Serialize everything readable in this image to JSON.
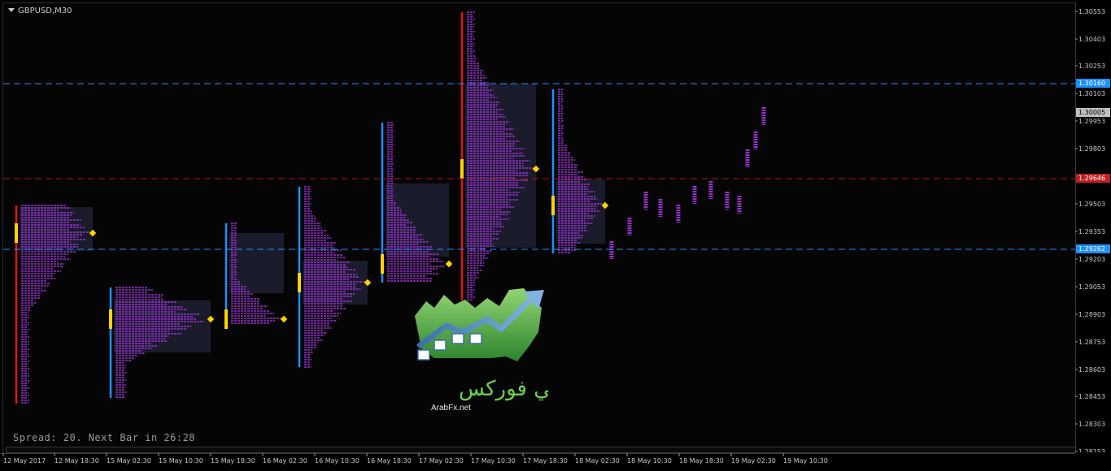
{
  "window": {
    "symbol_title": "GBPUSD,M30",
    "status_text": "Spread: 20. Next Bar in 26:28"
  },
  "watermark": {
    "arabic_text": "عربي فوركس",
    "site": "ArabFx.net"
  },
  "colors": {
    "background": "#000000",
    "profile": "#9a2fd0",
    "value_area": "#1a1c2c",
    "blue_line": "#1e90ff",
    "red_line": "#b01818",
    "poc": "#ffd400",
    "tag_blue": "#1e90ff",
    "tag_gray": "#bfbfbf",
    "tag_red": "#c02020"
  },
  "chart_data": {
    "type": "market_profile",
    "symbol": "GBPUSD",
    "timeframe": "M30",
    "y_ticks": [
      "1.30553",
      "1.30403",
      "1.30253",
      "1.30103",
      "1.29953",
      "1.29803",
      "1.29503",
      "1.29353",
      "1.29203",
      "1.29053",
      "1.28903",
      "1.28753",
      "1.28603",
      "1.28453",
      "1.28303",
      "1.28153"
    ],
    "ylim": [
      1.2815,
      1.306
    ],
    "price_tags": [
      {
        "label": "1.30160",
        "value": 1.3016,
        "style": "blue"
      },
      {
        "label": "1.30005",
        "value": 1.30005,
        "style": "gray"
      },
      {
        "label": "1.29646",
        "value": 1.29646,
        "style": "red"
      },
      {
        "label": "1.29262",
        "value": 1.29262,
        "style": "blue"
      }
    ],
    "horizontal_lines": [
      {
        "value": 1.3016,
        "style": "blue-dashed"
      },
      {
        "value": 1.29646,
        "style": "red-dashed"
      },
      {
        "value": 1.29262,
        "style": "blue-dashed"
      }
    ],
    "x_ticks": [
      "12 May 2017",
      "12 May 18:30",
      "15 May 02:30",
      "15 May 10:30",
      "15 May 18:30",
      "16 May 02:30",
      "16 May 10:30",
      "16 May 18:30",
      "17 May 02:30",
      "17 May 10:30",
      "17 May 18:30",
      "18 May 02:30",
      "18 May 10:30",
      "18 May 18:30",
      "19 May 02:30",
      "19 May 10:30"
    ],
    "profiles": [
      {
        "session": 1,
        "high": 1.295,
        "low": 1.2842,
        "value_area": [
          1.2925,
          1.2949
        ],
        "poc": 1.2935,
        "range_color": "red"
      },
      {
        "session": 2,
        "high": 1.2905,
        "low": 1.2845,
        "value_area": [
          1.287,
          1.2898
        ],
        "poc": 1.2888,
        "range_color": "blue"
      },
      {
        "session": 3,
        "high": 1.294,
        "low": 1.2885,
        "value_area": [
          1.2902,
          1.2935
        ],
        "poc": 1.2888,
        "range_color": "blue"
      },
      {
        "session": 4,
        "high": 1.296,
        "low": 1.2862,
        "value_area": [
          1.2896,
          1.292
        ],
        "poc": 1.2908,
        "range_color": "blue"
      },
      {
        "session": 5,
        "high": 1.2995,
        "low": 1.2908,
        "value_area": [
          1.2922,
          1.2962
        ],
        "poc": 1.2918,
        "range_color": "blue"
      },
      {
        "session": 6,
        "high": 1.3055,
        "low": 1.2898,
        "value_area": [
          1.2927,
          1.3016
        ],
        "poc": 1.297,
        "range_color": "red"
      },
      {
        "session": 7,
        "high": 1.3013,
        "low": 1.2924,
        "value_area": [
          1.2929,
          1.2964
        ],
        "poc": 1.295,
        "range_color": "blue"
      }
    ]
  }
}
